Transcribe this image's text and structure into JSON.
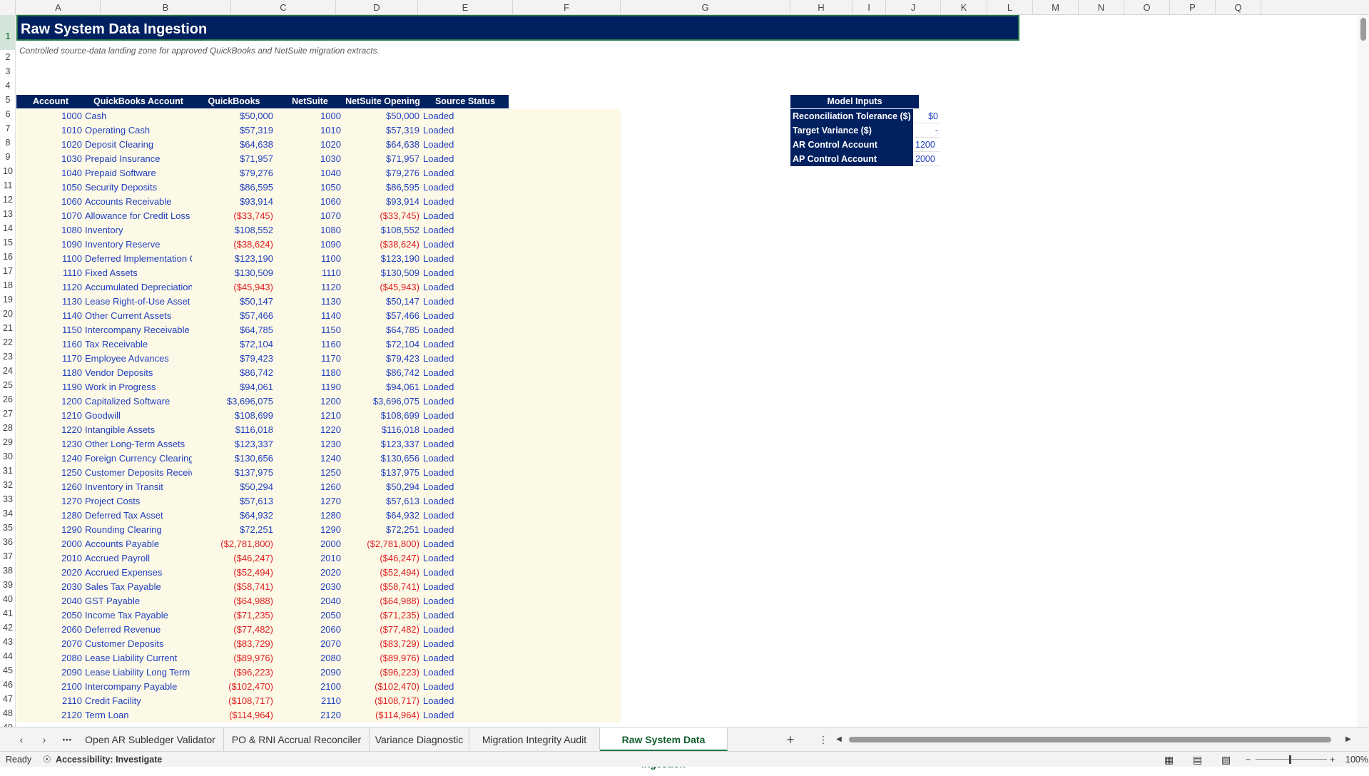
{
  "columns": [
    "A",
    "B",
    "C",
    "D",
    "E",
    "F",
    "G",
    "H",
    "I",
    "J",
    "K",
    "L",
    "M",
    "N",
    "O",
    "P",
    "Q"
  ],
  "sheet": {
    "title": "Raw System Data Ingestion",
    "subtitle": "Controlled source-data landing zone for approved QuickBooks and NetSuite migration extracts.",
    "headers": {
      "account": "Account",
      "qb_account": "QuickBooks Account",
      "qb_closing": "QuickBooks Closing TB",
      "ns_account": "NetSuite Account",
      "ns_opening": "NetSuite Opening TB",
      "status": "Source Status"
    },
    "rows": [
      {
        "acct": "1000",
        "name": "Cash",
        "qb": "$50,000",
        "ns_acct": "1000",
        "ns": "$50,000",
        "status": "Loaded"
      },
      {
        "acct": "1010",
        "name": "Operating Cash",
        "qb": "$57,319",
        "ns_acct": "1010",
        "ns": "$57,319",
        "status": "Loaded"
      },
      {
        "acct": "1020",
        "name": "Deposit Clearing",
        "qb": "$64,638",
        "ns_acct": "1020",
        "ns": "$64,638",
        "status": "Loaded"
      },
      {
        "acct": "1030",
        "name": "Prepaid Insurance",
        "qb": "$71,957",
        "ns_acct": "1030",
        "ns": "$71,957",
        "status": "Loaded"
      },
      {
        "acct": "1040",
        "name": "Prepaid Software",
        "qb": "$79,276",
        "ns_acct": "1040",
        "ns": "$79,276",
        "status": "Loaded"
      },
      {
        "acct": "1050",
        "name": "Security Deposits",
        "qb": "$86,595",
        "ns_acct": "1050",
        "ns": "$86,595",
        "status": "Loaded"
      },
      {
        "acct": "1060",
        "name": "Accounts Receivable",
        "qb": "$93,914",
        "ns_acct": "1060",
        "ns": "$93,914",
        "status": "Loaded"
      },
      {
        "acct": "1070",
        "name": "Allowance for Credit Loss",
        "qb": "($33,745)",
        "ns_acct": "1070",
        "ns": "($33,745)",
        "status": "Loaded"
      },
      {
        "acct": "1080",
        "name": "Inventory",
        "qb": "$108,552",
        "ns_acct": "1080",
        "ns": "$108,552",
        "status": "Loaded"
      },
      {
        "acct": "1090",
        "name": "Inventory Reserve",
        "qb": "($38,624)",
        "ns_acct": "1090",
        "ns": "($38,624)",
        "status": "Loaded"
      },
      {
        "acct": "1100",
        "name": "Deferred Implementation Cost",
        "qb": "$123,190",
        "ns_acct": "1100",
        "ns": "$123,190",
        "status": "Loaded"
      },
      {
        "acct": "1110",
        "name": "Fixed Assets",
        "qb": "$130,509",
        "ns_acct": "1110",
        "ns": "$130,509",
        "status": "Loaded"
      },
      {
        "acct": "1120",
        "name": "Accumulated Depreciation",
        "qb": "($45,943)",
        "ns_acct": "1120",
        "ns": "($45,943)",
        "status": "Loaded"
      },
      {
        "acct": "1130",
        "name": "Lease Right-of-Use Asset",
        "qb": "$50,147",
        "ns_acct": "1130",
        "ns": "$50,147",
        "status": "Loaded"
      },
      {
        "acct": "1140",
        "name": "Other Current Assets",
        "qb": "$57,466",
        "ns_acct": "1140",
        "ns": "$57,466",
        "status": "Loaded"
      },
      {
        "acct": "1150",
        "name": "Intercompany Receivable",
        "qb": "$64,785",
        "ns_acct": "1150",
        "ns": "$64,785",
        "status": "Loaded"
      },
      {
        "acct": "1160",
        "name": "Tax Receivable",
        "qb": "$72,104",
        "ns_acct": "1160",
        "ns": "$72,104",
        "status": "Loaded"
      },
      {
        "acct": "1170",
        "name": "Employee Advances",
        "qb": "$79,423",
        "ns_acct": "1170",
        "ns": "$79,423",
        "status": "Loaded"
      },
      {
        "acct": "1180",
        "name": "Vendor Deposits",
        "qb": "$86,742",
        "ns_acct": "1180",
        "ns": "$86,742",
        "status": "Loaded"
      },
      {
        "acct": "1190",
        "name": "Work in Progress",
        "qb": "$94,061",
        "ns_acct": "1190",
        "ns": "$94,061",
        "status": "Loaded"
      },
      {
        "acct": "1200",
        "name": "Capitalized Software",
        "qb": "$3,696,075",
        "ns_acct": "1200",
        "ns": "$3,696,075",
        "status": "Loaded"
      },
      {
        "acct": "1210",
        "name": "Goodwill",
        "qb": "$108,699",
        "ns_acct": "1210",
        "ns": "$108,699",
        "status": "Loaded"
      },
      {
        "acct": "1220",
        "name": "Intangible Assets",
        "qb": "$116,018",
        "ns_acct": "1220",
        "ns": "$116,018",
        "status": "Loaded"
      },
      {
        "acct": "1230",
        "name": "Other Long-Term Assets",
        "qb": "$123,337",
        "ns_acct": "1230",
        "ns": "$123,337",
        "status": "Loaded"
      },
      {
        "acct": "1240",
        "name": "Foreign Currency Clearing",
        "qb": "$130,656",
        "ns_acct": "1240",
        "ns": "$130,656",
        "status": "Loaded"
      },
      {
        "acct": "1250",
        "name": "Customer Deposits Receivable",
        "qb": "$137,975",
        "ns_acct": "1250",
        "ns": "$137,975",
        "status": "Loaded"
      },
      {
        "acct": "1260",
        "name": "Inventory in Transit",
        "qb": "$50,294",
        "ns_acct": "1260",
        "ns": "$50,294",
        "status": "Loaded"
      },
      {
        "acct": "1270",
        "name": "Project Costs",
        "qb": "$57,613",
        "ns_acct": "1270",
        "ns": "$57,613",
        "status": "Loaded"
      },
      {
        "acct": "1280",
        "name": "Deferred Tax Asset",
        "qb": "$64,932",
        "ns_acct": "1280",
        "ns": "$64,932",
        "status": "Loaded"
      },
      {
        "acct": "1290",
        "name": "Rounding Clearing",
        "qb": "$72,251",
        "ns_acct": "1290",
        "ns": "$72,251",
        "status": "Loaded"
      },
      {
        "acct": "2000",
        "name": "Accounts Payable",
        "qb": "($2,781,800)",
        "ns_acct": "2000",
        "ns": "($2,781,800)",
        "status": "Loaded"
      },
      {
        "acct": "2010",
        "name": "Accrued Payroll",
        "qb": "($46,247)",
        "ns_acct": "2010",
        "ns": "($46,247)",
        "status": "Loaded"
      },
      {
        "acct": "2020",
        "name": "Accrued Expenses",
        "qb": "($52,494)",
        "ns_acct": "2020",
        "ns": "($52,494)",
        "status": "Loaded"
      },
      {
        "acct": "2030",
        "name": "Sales Tax Payable",
        "qb": "($58,741)",
        "ns_acct": "2030",
        "ns": "($58,741)",
        "status": "Loaded"
      },
      {
        "acct": "2040",
        "name": "GST Payable",
        "qb": "($64,988)",
        "ns_acct": "2040",
        "ns": "($64,988)",
        "status": "Loaded"
      },
      {
        "acct": "2050",
        "name": "Income Tax Payable",
        "qb": "($71,235)",
        "ns_acct": "2050",
        "ns": "($71,235)",
        "status": "Loaded"
      },
      {
        "acct": "2060",
        "name": "Deferred Revenue",
        "qb": "($77,482)",
        "ns_acct": "2060",
        "ns": "($77,482)",
        "status": "Loaded"
      },
      {
        "acct": "2070",
        "name": "Customer Deposits",
        "qb": "($83,729)",
        "ns_acct": "2070",
        "ns": "($83,729)",
        "status": "Loaded"
      },
      {
        "acct": "2080",
        "name": "Lease Liability Current",
        "qb": "($89,976)",
        "ns_acct": "2080",
        "ns": "($89,976)",
        "status": "Loaded"
      },
      {
        "acct": "2090",
        "name": "Lease Liability Long Term",
        "qb": "($96,223)",
        "ns_acct": "2090",
        "ns": "($96,223)",
        "status": "Loaded"
      },
      {
        "acct": "2100",
        "name": "Intercompany Payable",
        "qb": "($102,470)",
        "ns_acct": "2100",
        "ns": "($102,470)",
        "status": "Loaded"
      },
      {
        "acct": "2110",
        "name": "Credit Facility",
        "qb": "($108,717)",
        "ns_acct": "2110",
        "ns": "($108,717)",
        "status": "Loaded"
      },
      {
        "acct": "2120",
        "name": "Term Loan",
        "qb": "($114,964)",
        "ns_acct": "2120",
        "ns": "($114,964)",
        "status": "Loaded"
      }
    ],
    "model_inputs": {
      "title": "Model Inputs",
      "items": [
        {
          "label": "Reconciliation Tolerance ($)",
          "value": "$0",
          "align": "right"
        },
        {
          "label": "Target Variance ($)",
          "value": "-",
          "align": "right"
        },
        {
          "label": "AR Control Account",
          "value": "1200",
          "align": "left"
        },
        {
          "label": "AP Control Account",
          "value": "2000",
          "align": "left"
        }
      ]
    }
  },
  "tabs": [
    {
      "label": "Open AR Subledger Validator",
      "active": false
    },
    {
      "label": "PO & RNI Accrual Reconciler",
      "active": false
    },
    {
      "label": "Variance Diagnostic",
      "active": false
    },
    {
      "label": "Migration Integrity Audit",
      "active": false
    },
    {
      "label": "Raw System Data Ingestion",
      "active": true
    }
  ],
  "statusbar": {
    "ready": "Ready",
    "accessibility": "Accessibility: Investigate",
    "zoom": "100%"
  },
  "colors": {
    "header_navy": "#002060",
    "row_fill": "#fdf9e7",
    "positive_blue": "#1f3fbf",
    "negative_red": "#e02020",
    "excel_green": "#217346"
  }
}
